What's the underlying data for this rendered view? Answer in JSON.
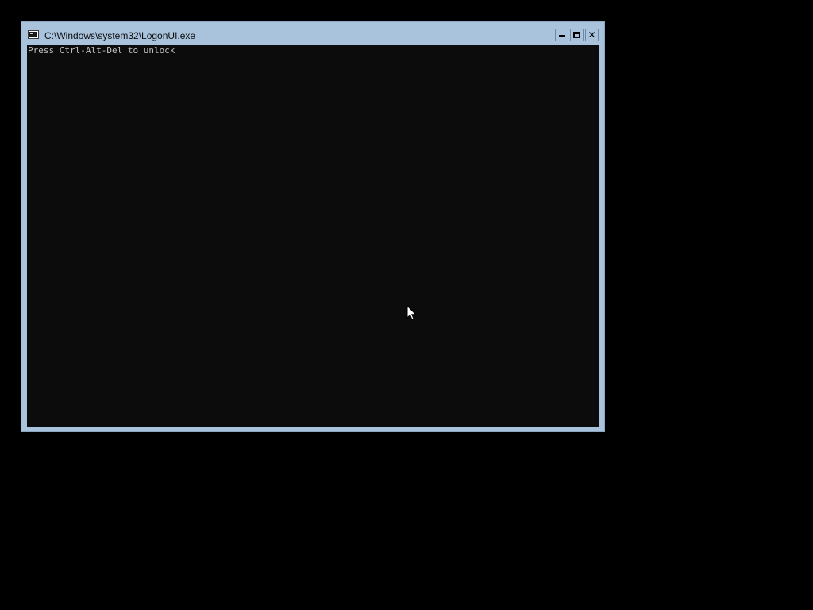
{
  "window": {
    "title": "C:\\Windows\\system32\\LogonUI.exe",
    "icon": "console-app-icon",
    "controls": {
      "minimize": "minimize-icon",
      "maximize": "maximize-icon",
      "close": "close-icon",
      "close_glyph": "✕"
    }
  },
  "console": {
    "lines": [
      "Press Ctrl-Alt-Del to unlock"
    ],
    "background": "#0c0c0c",
    "foreground": "#c0c0c0"
  },
  "theme": {
    "frame": "#a9c3dd",
    "desktop": "#000000"
  },
  "pointer": {
    "icon": "mouse-pointer-icon"
  }
}
